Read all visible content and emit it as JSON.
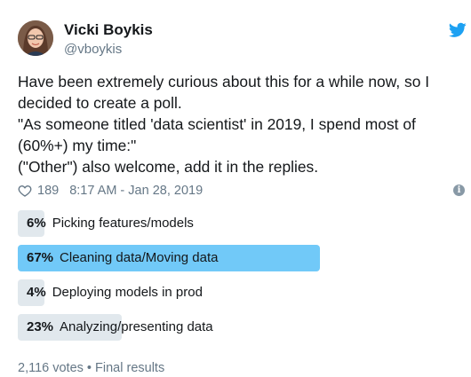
{
  "tweet": {
    "author_name": "Vicki Boykis",
    "author_handle": "@vboykis",
    "lines": [
      "Have been extremely curious about this for a while now, so I",
      "decided to create a poll.",
      "\"As someone titled 'data scientist' in 2019, I spend most of",
      "(60%+)  my time:\"",
      "(\"Other\") also welcome, add it in the replies."
    ],
    "likes": "189",
    "timestamp": "8:17 AM - Jan 28, 2019"
  },
  "poll": {
    "options": [
      {
        "percent_label": "6%",
        "label": "Picking features/models",
        "value": 6,
        "winner": false
      },
      {
        "percent_label": "67%",
        "label": "Cleaning data/Moving data",
        "value": 67,
        "winner": true
      },
      {
        "percent_label": "4%",
        "label": "Deploying models in prod",
        "value": 4,
        "winner": false
      },
      {
        "percent_label": "23%",
        "label": "Analyzing/presenting data",
        "value": 23,
        "winner": false
      }
    ],
    "footer": "2,116 votes • Final results"
  },
  "colors": {
    "winner_bar": "#71c9f8",
    "bar": "#e1e8ed",
    "twitter_blue": "#1da1f2"
  },
  "icons": [
    "avatar",
    "twitter-bird-icon",
    "heart-icon",
    "info-icon"
  ]
}
